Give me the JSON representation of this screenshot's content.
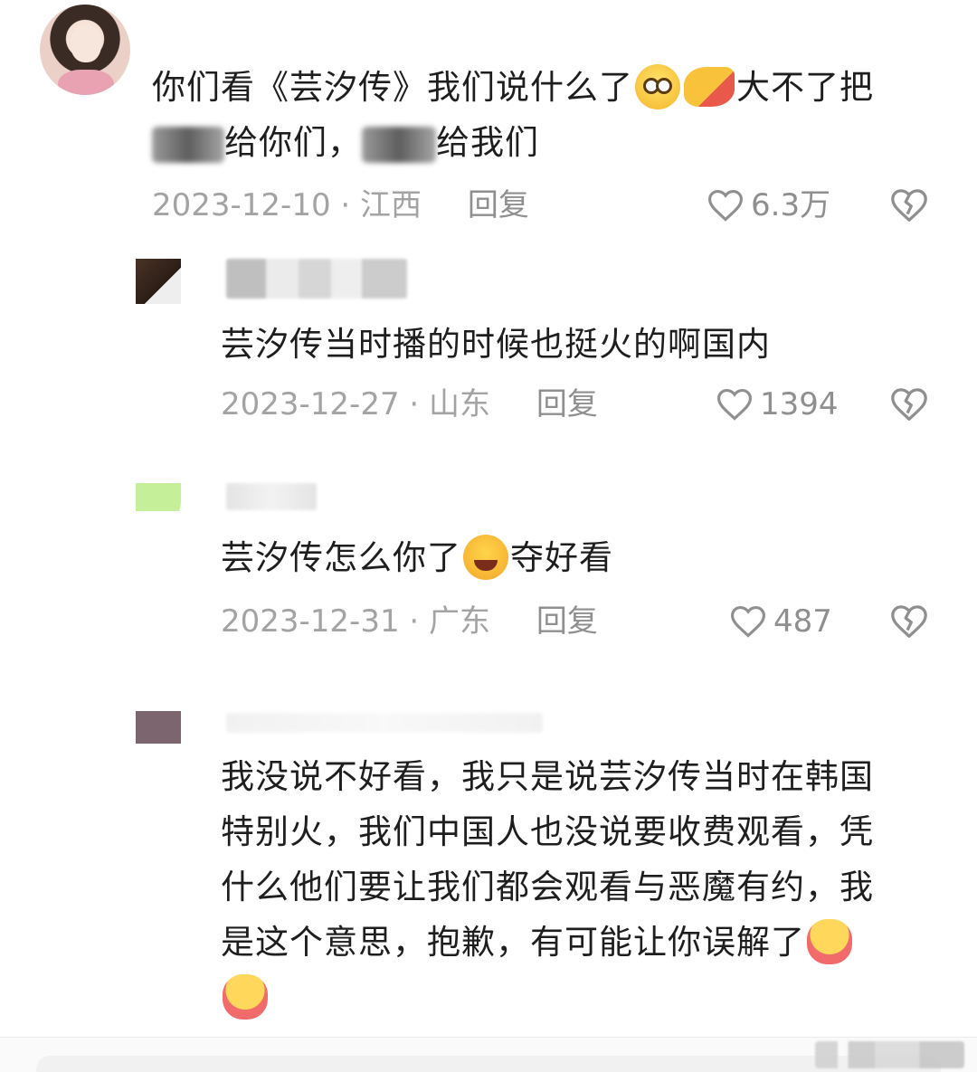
{
  "comments": [
    {
      "text_a": "你们看《芸汐传》我们说什么了",
      "text_b": "大不了把",
      "text_c": "给你们，",
      "text_d": "给我们",
      "date": "2023-12-10",
      "sep": "·",
      "location": "江西",
      "reply_label": "回复",
      "likes": "6.3万"
    },
    {
      "text": "芸汐传当时播的时候也挺火的啊国内",
      "date": "2023-12-27",
      "sep": "·",
      "location": "山东",
      "reply_label": "回复",
      "likes": "1394"
    },
    {
      "text_a": "芸汐传怎么你了",
      "text_b": "夺好看",
      "date": "2023-12-31",
      "sep": "·",
      "location": "广东",
      "reply_label": "回复",
      "likes": "487"
    },
    {
      "line1": "我没说不好看，我只是说芸汐传当时在韩国",
      "line2": "特别火，我们中国人也没说要收费观看，凭",
      "line3": "什么他们要让我们都会观看与恶魔有约，我",
      "line4": "是这个意思，抱歉，有可能让你误解了"
    }
  ],
  "icons": {
    "like": "heart-outline-icon",
    "dislike": "broken-heart-icon",
    "emojis": [
      "grinning-face-emoji",
      "pointing-hand-emoji",
      "laughing-crying-emoji",
      "hugging-face-emoji"
    ]
  },
  "colors": {
    "text": "#1e1e1e",
    "meta": "#a3a3a3",
    "icon": "#8f8f8f"
  }
}
